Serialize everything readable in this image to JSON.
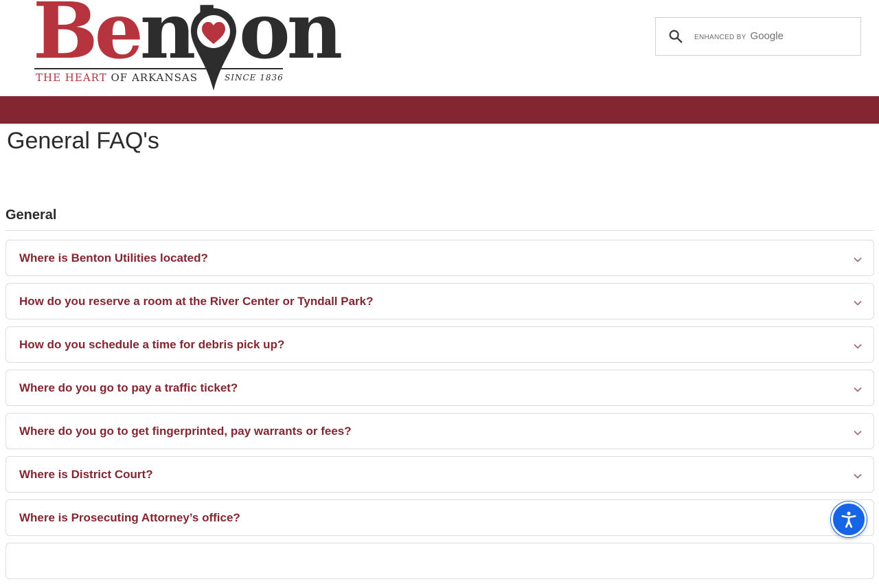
{
  "header": {
    "logo": {
      "word_be": "Be",
      "word_nt": "nt",
      "word_on": "on",
      "tagline_red": "THE HEART",
      "tagline_dark": "OF ARKANSAS",
      "since": "SINCE 1836"
    },
    "search": {
      "enhanced_by": "ENHANCED BY",
      "provider": "Google"
    }
  },
  "page": {
    "title": "General FAQ's",
    "section_title": "General"
  },
  "faqs": [
    {
      "question": "Where is Benton Utilities located?"
    },
    {
      "question": "How do you reserve a room at the River Center or Tyndall Park?"
    },
    {
      "question": "How do you schedule a time for debris pick up?"
    },
    {
      "question": "Where do you go to pay a traffic ticket?"
    },
    {
      "question": "Where do you go to get fingerprinted, pay warrants or fees?"
    },
    {
      "question": "Where is District Court?"
    },
    {
      "question": "Where is Prosecuting Attorney’s office?"
    }
  ],
  "colors": {
    "brand_red": "#832632",
    "logo_red": "#b5343e",
    "accessibility_blue": "#1565e6"
  },
  "icons": {
    "search": "search-icon",
    "chevron": "chevron-down-icon",
    "accessibility": "accessibility-icon"
  }
}
